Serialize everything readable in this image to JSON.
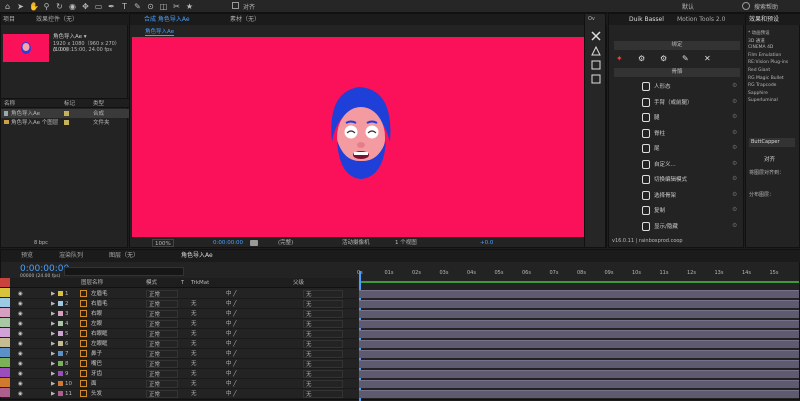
{
  "toolbar": {
    "align_label": "对齐",
    "workspace_default": "默认",
    "search_label": "搜索帮助",
    "icons": [
      "home-icon",
      "arrow-icon",
      "hand-icon",
      "zoom-icon",
      "rotate-icon",
      "camera-icon",
      "pan-icon",
      "rect-icon",
      "pen-icon",
      "type-icon",
      "brush-icon",
      "stamp-icon",
      "eraser-icon",
      "roto-icon",
      "puppet-icon"
    ]
  },
  "project": {
    "tab": "项目",
    "effects_tab": "效果控件（无）",
    "comp_name": "角色导入Ae ▾",
    "comp_info1": "1920 x 1080（960 x 270）(1.00)",
    "comp_info2": "Δ 0:00:15:00, 24.00 fps",
    "col_name": "名称",
    "col_tag": "标记",
    "col_type": "类型",
    "items": [
      {
        "name": "角色导入Ae",
        "type": "合成"
      },
      {
        "name": "角色导入Ae 个图层",
        "type": "文件夹"
      }
    ],
    "bpc": "8 bpc"
  },
  "comp": {
    "tab_label": "合成 角色导入Ae",
    "tab_sub": "角色导入Ae",
    "footage_tab": "素材（无）",
    "canvas_color": "#fb1159",
    "zoom": "100%",
    "timecode": "0:00:00:00",
    "view_mode": "(完整)",
    "camera": "活动摄像机",
    "view_count": "1 个视图",
    "exposure": "+0.0"
  },
  "side_icons": [
    "cross-icon",
    "triangle-icon",
    "square-icon"
  ],
  "duik": {
    "tab": "Duik Bassel",
    "tab2": "Motion Tools 2.0",
    "section1": "绑定",
    "section2": "骨骼",
    "items": [
      "人形态",
      "手臂（或前腿）",
      "腿",
      "脊柱",
      "尾",
      "自定义...",
      "切换编辑模式",
      "选择骨架",
      "复制",
      "显示/隐藏"
    ],
    "version": "v16.0.11 | rainboxprod.coop"
  },
  "effects": {
    "tab": "效果和预设",
    "items": [
      "* 动画预设",
      "3D 通道",
      "CINEMA 4D",
      "Film Emulation",
      "RE:Vision Plug-ins",
      "Red Giant",
      "RG Magic Bullet",
      "RG Trapcode",
      "Sapphire",
      "Superluminal"
    ],
    "buttcapper": "ButtCapper",
    "align_tab": "对齐",
    "align_to": "将图层对齐到：",
    "distribute": "分布图层："
  },
  "timeline": {
    "tabs": [
      "渲染队列",
      "图层（无）",
      "角色导入Ae"
    ],
    "timecode": "0:00:00:00",
    "fps_line": "00000 (24.00 fps)",
    "col_name": "图层名称",
    "col_mode": "模式",
    "col_t": "T",
    "col_trkmat": "TrkMat",
    "col_parent": "父级",
    "ruler": [
      "0s",
      "01s",
      "02s",
      "03s",
      "04s",
      "05s",
      "06s",
      "07s",
      "08s",
      "09s",
      "10s",
      "11s",
      "12s",
      "13s",
      "14s",
      "15s"
    ],
    "layers": [
      {
        "n": "1",
        "name": "左眉毛",
        "mode": "正常",
        "trk": "",
        "parent": "无"
      },
      {
        "n": "2",
        "name": "右眉毛",
        "mode": "正常",
        "trk": "无",
        "parent": "无"
      },
      {
        "n": "3",
        "name": "右眼",
        "mode": "正常",
        "trk": "无",
        "parent": "无"
      },
      {
        "n": "4",
        "name": "左眼",
        "mode": "正常",
        "trk": "无",
        "parent": "无"
      },
      {
        "n": "5",
        "name": "右眼眶",
        "mode": "正常",
        "trk": "无",
        "parent": "无"
      },
      {
        "n": "6",
        "name": "左眼眶",
        "mode": "正常",
        "trk": "无",
        "parent": "无"
      },
      {
        "n": "7",
        "name": "鼻子",
        "mode": "正常",
        "trk": "无",
        "parent": "无"
      },
      {
        "n": "8",
        "name": "嘴巴",
        "mode": "正常",
        "trk": "无",
        "parent": "无"
      },
      {
        "n": "9",
        "name": "牙齿",
        "mode": "正常",
        "trk": "无",
        "parent": "无"
      },
      {
        "n": "10",
        "name": "面",
        "mode": "正常",
        "trk": "无",
        "parent": "无"
      },
      {
        "n": "11",
        "name": "头发",
        "mode": "正常",
        "trk": "无",
        "parent": "无"
      }
    ],
    "label_colors": [
      "#c9433c",
      "#d8c43c",
      "#9bcae4",
      "#d99fc2",
      "#a7c8a2",
      "#d0a2d7",
      "#c7bb92",
      "#5c90c8",
      "#7bb258",
      "#9c4dbd",
      "#d07a2e",
      "#ae5f8e"
    ]
  }
}
